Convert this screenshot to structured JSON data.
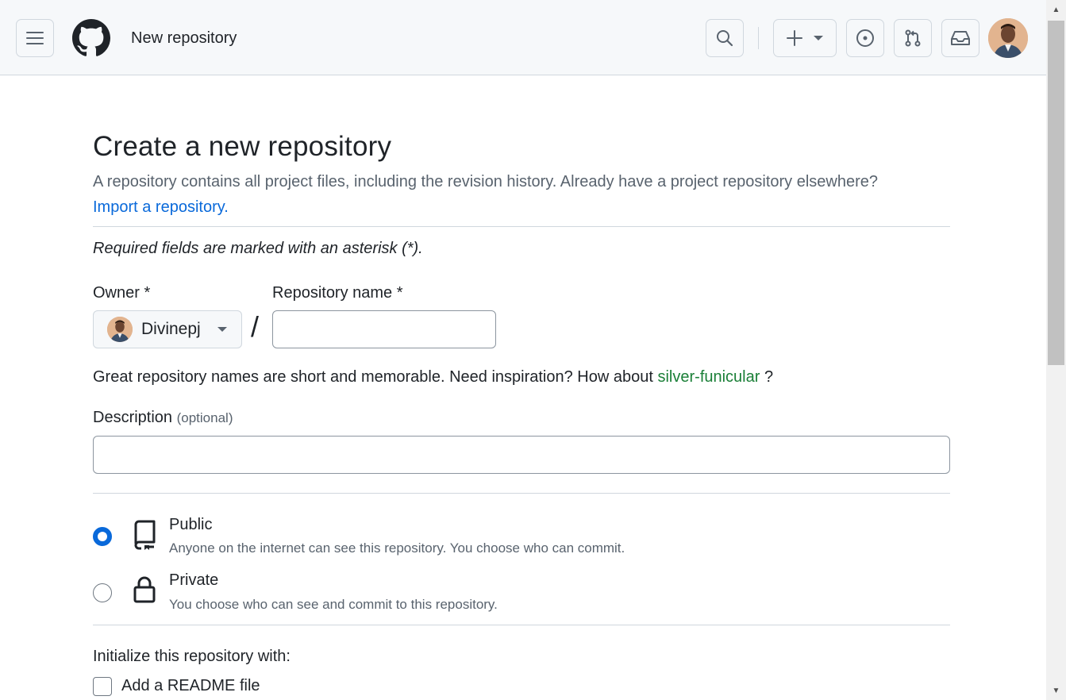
{
  "header": {
    "title": "New repository",
    "menu_icon": "hamburger-icon",
    "logo_icon": "github-logo",
    "search_icon": "search-icon",
    "create_icon": "plus-icon",
    "issues_icon": "issue-opened-icon",
    "pulls_icon": "git-pull-request-icon",
    "inbox_icon": "inbox-icon"
  },
  "main": {
    "heading": "Create a new repository",
    "subtitle": "A repository contains all project files, including the revision history. Already have a project repository elsewhere?",
    "import_link": "Import a repository.",
    "required_note": "Required fields are marked with an asterisk (*).",
    "owner_label": "Owner *",
    "owner_name": "Divinepj",
    "slash": "/",
    "repo_name_label": "Repository name *",
    "repo_name_value": "",
    "hint_prefix": "Great repository names are short and memorable. Need inspiration? How about",
    "hint_suggestion": "silver-funicular",
    "hint_suffix": " ?",
    "description_label": "Description",
    "description_optional": "(optional)",
    "description_value": "",
    "visibility": {
      "selected": "Public",
      "options": [
        {
          "title": "Public",
          "desc": "Anyone on the internet can see this repository. You choose who can commit.",
          "icon": "repo-icon"
        },
        {
          "title": "Private",
          "desc": "You choose who can see and commit to this repository.",
          "icon": "lock-icon"
        }
      ]
    },
    "initialize_label": "Initialize this repository with:",
    "readme_label": "Add a README file",
    "readme_checked": false
  },
  "colors": {
    "accent": "#0969da",
    "suggestion": "#1a7f37",
    "header_bg": "#f6f8fa",
    "border": "#d0d7de"
  }
}
